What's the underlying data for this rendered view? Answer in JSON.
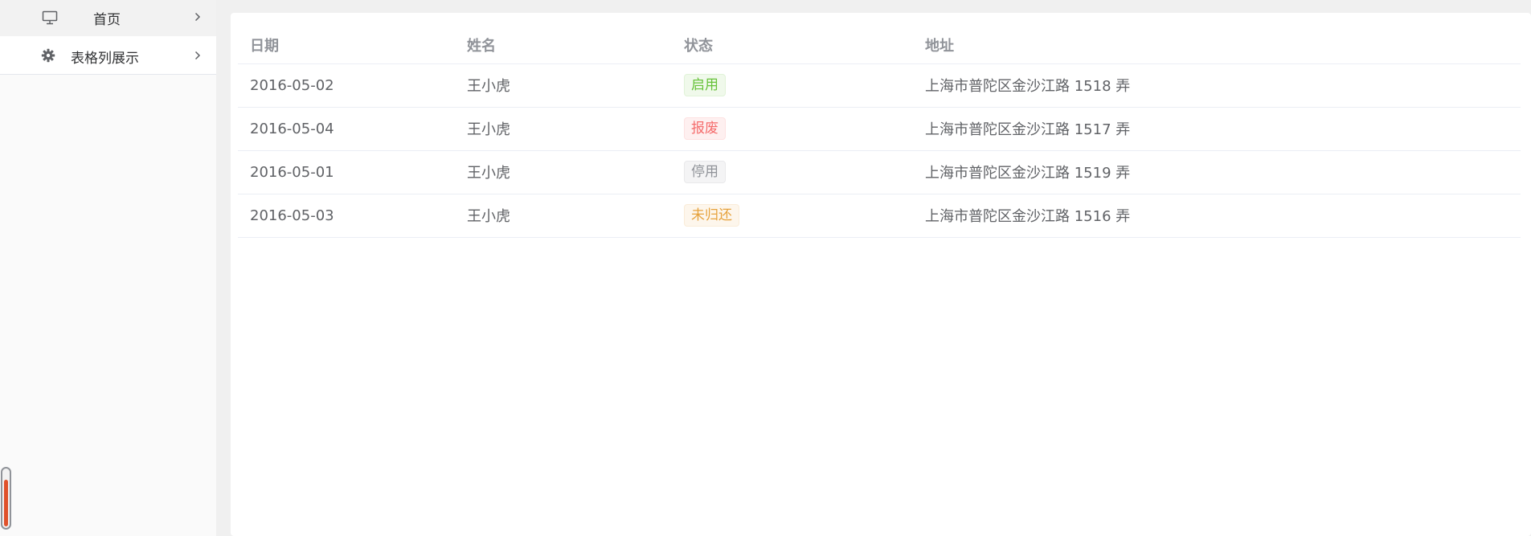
{
  "sidebar": {
    "items": [
      {
        "label": "首页",
        "icon": "monitor-icon"
      },
      {
        "label": "表格列展示",
        "icon": "gear-icon"
      }
    ],
    "scroll_indicator": {
      "fill_fraction": 0.78,
      "color": "#e0522b"
    }
  },
  "table": {
    "columns": [
      "日期",
      "姓名",
      "状态",
      "地址"
    ],
    "rows": [
      {
        "date": "2016-05-02",
        "name": "王小虎",
        "status": "启用",
        "status_type": "success",
        "address": "上海市普陀区金沙江路 1518 弄"
      },
      {
        "date": "2016-05-04",
        "name": "王小虎",
        "status": "报废",
        "status_type": "danger",
        "address": "上海市普陀区金沙江路 1517 弄"
      },
      {
        "date": "2016-05-01",
        "name": "王小虎",
        "status": "停用",
        "status_type": "info",
        "address": "上海市普陀区金沙江路 1519 弄"
      },
      {
        "date": "2016-05-03",
        "name": "王小虎",
        "status": "未归还",
        "status_type": "warning",
        "address": "上海市普陀区金沙江路 1516 弄"
      }
    ]
  },
  "colors": {
    "success": "#67c23a",
    "danger": "#f56c6c",
    "info": "#909399",
    "warning": "#e6a23c"
  }
}
